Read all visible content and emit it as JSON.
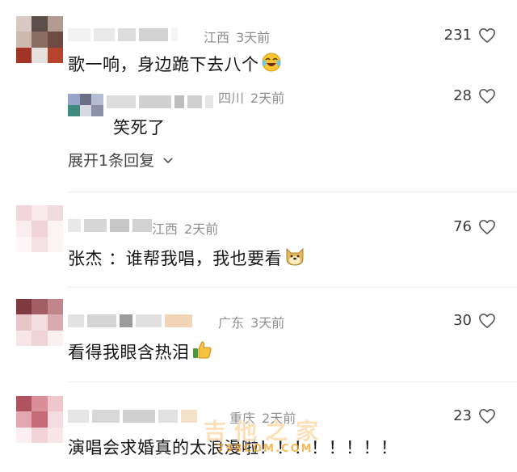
{
  "comments": [
    {
      "location": "江西",
      "time": "3天前",
      "text": "歌一响，身边跪下去八个",
      "emoji": "laughing-tears-emoji",
      "likes": "231",
      "reply": {
        "location": "四川",
        "time": "2天前",
        "text": "笑死了",
        "likes": "28"
      },
      "expand_label": "展开1条回复"
    },
    {
      "location": "江西",
      "time": "2天前",
      "text": "张杰 ：谁帮我唱，我也要看",
      "emoji": "doge-emoji",
      "likes": "76"
    },
    {
      "location": "广东",
      "time": "3天前",
      "text": "看得我眼含热泪",
      "emoji": "thumbs-up-emoji",
      "likes": "30"
    },
    {
      "location": "重庆",
      "time": "2天前",
      "text": "演唱会求婚真的太浪漫啦！！！！！！！！",
      "likes": "23"
    }
  ],
  "watermark": {
    "main": "吉他之家",
    "sub": "798COM.COM"
  },
  "colors": {
    "meta": "#8f8f8f",
    "watermark": "#f6a028"
  }
}
